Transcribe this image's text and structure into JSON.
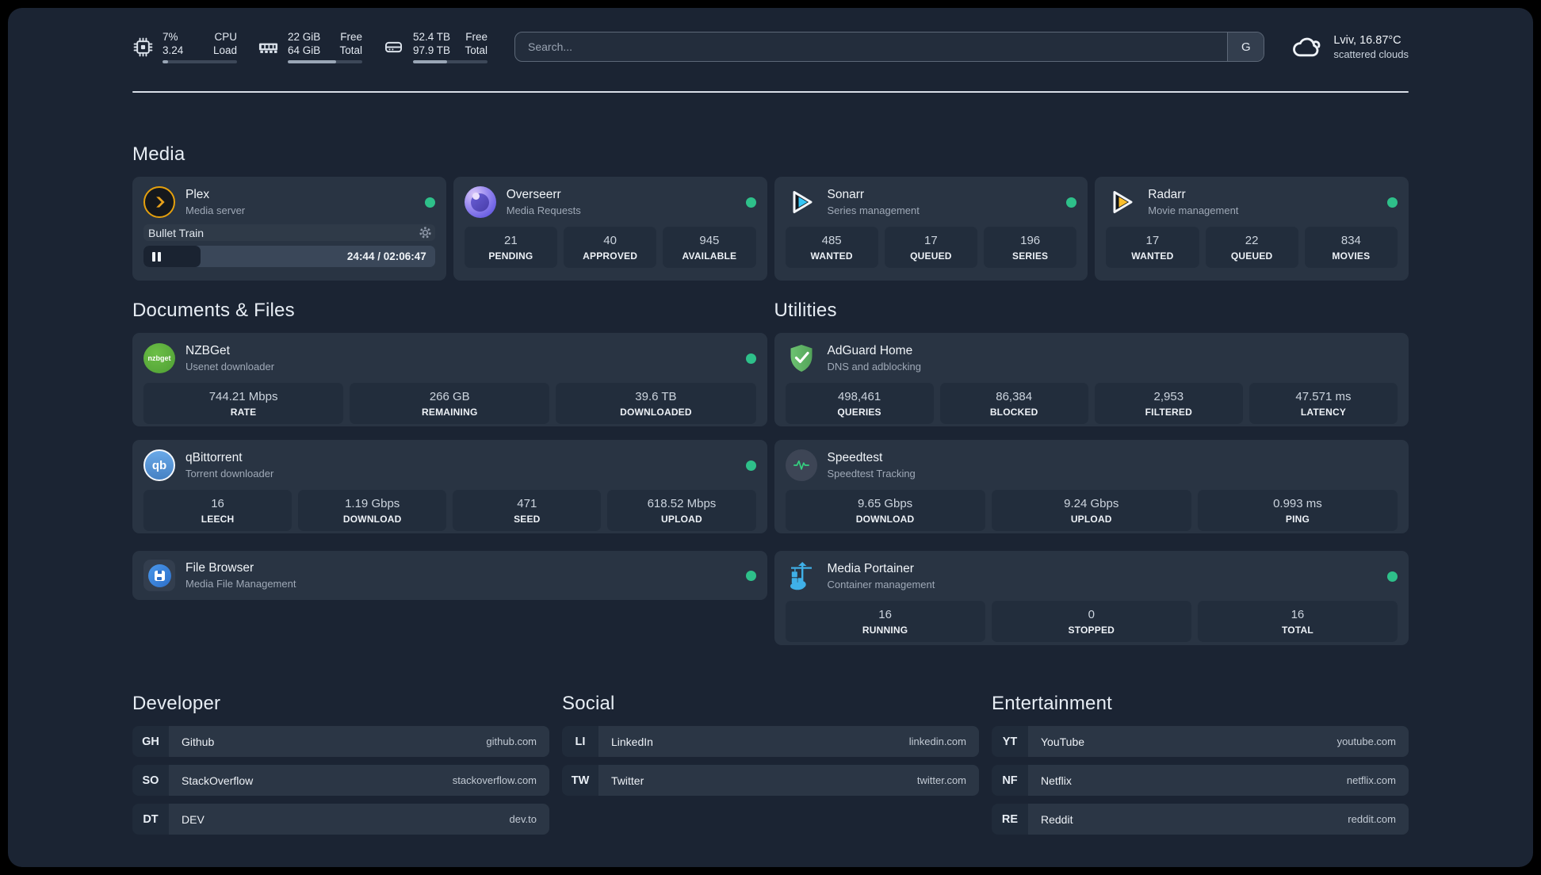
{
  "theme": {
    "bg": "#1b2433",
    "card": "#293443",
    "tile": "#222d3c",
    "status_green": "#2ec08a",
    "plex_gold": "#e5a00d"
  },
  "topbar": {
    "resources": [
      {
        "icon": "cpu-icon",
        "rows": [
          {
            "value": "7%",
            "label": "CPU"
          },
          {
            "value": "3.24",
            "label": "Load"
          }
        ],
        "progress_pct": 7
      },
      {
        "icon": "memory-icon",
        "rows": [
          {
            "value": "22 GiB",
            "label": "Free"
          },
          {
            "value": "64 GiB",
            "label": "Total"
          }
        ],
        "progress_pct": 65
      },
      {
        "icon": "disk-icon",
        "rows": [
          {
            "value": "52.4 TB",
            "label": "Free"
          },
          {
            "value": "97.9 TB",
            "label": "Total"
          }
        ],
        "progress_pct": 46
      }
    ],
    "search": {
      "placeholder": "Search...",
      "provider_label": "G"
    },
    "weather": {
      "icon": "cloud-icon",
      "headline": "Lviv, 16.87°C",
      "condition": "scattered clouds"
    }
  },
  "sections": {
    "media": {
      "title": "Media"
    },
    "documents": {
      "title": "Documents & Files"
    },
    "utilities": {
      "title": "Utilities"
    },
    "developer": {
      "title": "Developer"
    },
    "social": {
      "title": "Social"
    },
    "entertainment": {
      "title": "Entertainment"
    }
  },
  "services": {
    "plex": {
      "icon": "plex-icon",
      "name": "Plex",
      "desc": "Media server",
      "status": "online",
      "now_playing": {
        "title": "Bullet Train",
        "state": "paused",
        "time_display": "24:44 / 02:06:47",
        "progress_pct": 19.5
      }
    },
    "overseerr": {
      "icon": "overseerr-icon",
      "name": "Overseerr",
      "desc": "Media Requests",
      "status": "online",
      "stats": [
        {
          "value": "21",
          "label": "PENDING"
        },
        {
          "value": "40",
          "label": "APPROVED"
        },
        {
          "value": "945",
          "label": "AVAILABLE"
        }
      ]
    },
    "sonarr": {
      "icon": "sonarr-icon",
      "name": "Sonarr",
      "desc": "Series management",
      "status": "online",
      "stats": [
        {
          "value": "485",
          "label": "WANTED"
        },
        {
          "value": "17",
          "label": "QUEUED"
        },
        {
          "value": "196",
          "label": "SERIES"
        }
      ]
    },
    "radarr": {
      "icon": "radarr-icon",
      "name": "Radarr",
      "desc": "Movie management",
      "status": "online",
      "stats": [
        {
          "value": "17",
          "label": "WANTED"
        },
        {
          "value": "22",
          "label": "QUEUED"
        },
        {
          "value": "834",
          "label": "MOVIES"
        }
      ]
    },
    "nzbget": {
      "icon": "nzbget-icon",
      "name": "NZBGet",
      "desc": "Usenet downloader",
      "status": "online",
      "stats": [
        {
          "value": "744.21 Mbps",
          "label": "RATE"
        },
        {
          "value": "266 GB",
          "label": "REMAINING"
        },
        {
          "value": "39.6 TB",
          "label": "DOWNLOADED"
        }
      ]
    },
    "qbittorrent": {
      "icon": "qbittorrent-icon",
      "name": "qBittorrent",
      "desc": "Torrent downloader",
      "status": "online",
      "stats": [
        {
          "value": "16",
          "label": "LEECH"
        },
        {
          "value": "1.19 Gbps",
          "label": "DOWNLOAD"
        },
        {
          "value": "471",
          "label": "SEED"
        },
        {
          "value": "618.52 Mbps",
          "label": "UPLOAD"
        }
      ]
    },
    "filebrowser": {
      "icon": "filebrowser-icon",
      "name": "File Browser",
      "desc": "Media File Management",
      "status": "online"
    },
    "adguard": {
      "icon": "adguard-icon",
      "name": "AdGuard Home",
      "desc": "DNS and adblocking",
      "stats": [
        {
          "value": "498,461",
          "label": "QUERIES"
        },
        {
          "value": "86,384",
          "label": "BLOCKED"
        },
        {
          "value": "2,953",
          "label": "FILTERED"
        },
        {
          "value": "47.571 ms",
          "label": "LATENCY"
        }
      ]
    },
    "speedtest": {
      "icon": "speedtest-icon",
      "name": "Speedtest",
      "desc": "Speedtest Tracking",
      "stats": [
        {
          "value": "9.65 Gbps",
          "label": "DOWNLOAD"
        },
        {
          "value": "9.24 Gbps",
          "label": "UPLOAD"
        },
        {
          "value": "0.993 ms",
          "label": "PING"
        }
      ]
    },
    "portainer": {
      "icon": "portainer-icon",
      "name": "Media Portainer",
      "desc": "Container management",
      "status": "online",
      "stats": [
        {
          "value": "16",
          "label": "RUNNING"
        },
        {
          "value": "0",
          "label": "STOPPED"
        },
        {
          "value": "16",
          "label": "TOTAL"
        }
      ]
    }
  },
  "bookmarks": {
    "developer": {
      "items": [
        {
          "abbr": "GH",
          "name": "Github",
          "url": "github.com"
        },
        {
          "abbr": "SO",
          "name": "StackOverflow",
          "url": "stackoverflow.com"
        },
        {
          "abbr": "DT",
          "name": "DEV",
          "url": "dev.to"
        }
      ]
    },
    "social": {
      "items": [
        {
          "abbr": "LI",
          "name": "LinkedIn",
          "url": "linkedin.com"
        },
        {
          "abbr": "TW",
          "name": "Twitter",
          "url": "twitter.com"
        }
      ]
    },
    "entertainment": {
      "items": [
        {
          "abbr": "YT",
          "name": "YouTube",
          "url": "youtube.com"
        },
        {
          "abbr": "NF",
          "name": "Netflix",
          "url": "netflix.com"
        },
        {
          "abbr": "RE",
          "name": "Reddit",
          "url": "reddit.com"
        }
      ]
    }
  }
}
